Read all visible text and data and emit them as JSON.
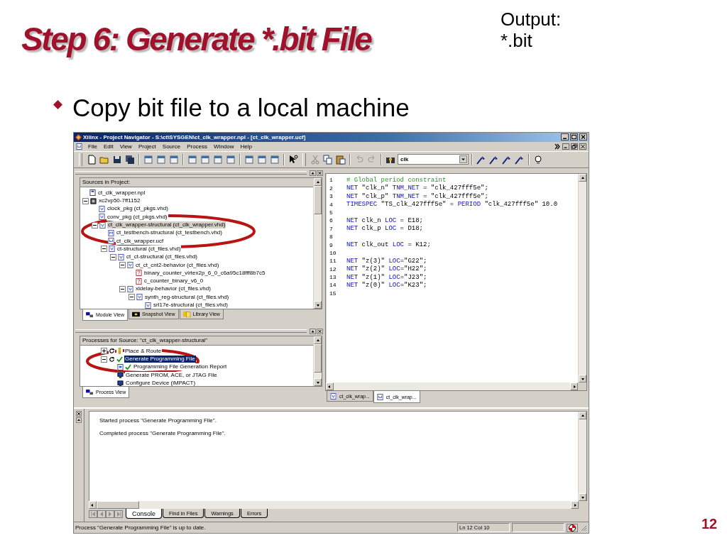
{
  "slide": {
    "title": "Step 6: Generate *.bit File",
    "note": [
      "Output:",
      "*.bit"
    ],
    "bullet": "Copy bit file to a local machine",
    "page_number": "12"
  },
  "window": {
    "title": "Xilinx - Project Navigator - S:\\ct\\SYSGEN\\ct_clk_wrapper.npl - [ct_clk_wrapper.ucf]",
    "menu": [
      "File",
      "Edit",
      "View",
      "Project",
      "Source",
      "Process",
      "Window",
      "Help"
    ],
    "toolbar": {
      "search_value": "clk"
    },
    "sources": {
      "header": "Sources in Project:",
      "tree": [
        {
          "label": "ct_clk_wrapper.npl",
          "kind": "project",
          "selected": false
        },
        {
          "label": "xc2vp50-7ff1152",
          "kind": "device",
          "expanded": true,
          "selected": false,
          "children": [
            {
              "label": "clock_pkg (ct_pkgs.vhd)",
              "kind": "vhdl",
              "selected": false
            },
            {
              "label": "conv_pkg (ct_pkgs.vhd)",
              "kind": "vhdl",
              "selected": false
            },
            {
              "label": "ct_clk_wrapper-structural (ct_clk_wrapper.vhd)",
              "kind": "vhdl",
              "expanded": true,
              "selected": true,
              "children": [
                {
                  "label": "ct_testbench-structural (ct_testbench.vhd)",
                  "kind": "testbench",
                  "selected": false
                },
                {
                  "label": "ct_clk_wrapper.ucf",
                  "kind": "ucf",
                  "selected": false
                },
                {
                  "label": "ct-structural (ct_files.vhd)",
                  "kind": "vhdl",
                  "expanded": true,
                  "selected": false,
                  "children": [
                    {
                      "label": "ct_ct-structural (ct_files.vhd)",
                      "kind": "vhdl",
                      "expanded": true,
                      "selected": false,
                      "children": [
                        {
                          "label": "ct_ct_cnt2-behavior (ct_files.vhd)",
                          "kind": "vhdl",
                          "expanded": true,
                          "selected": false,
                          "children": [
                            {
                              "label": "binary_counter_virtex2p_6_0_c6a95c18fff8b7c5",
                              "kind": "core",
                              "selected": false
                            },
                            {
                              "label": "c_counter_binary_v6_0",
                              "kind": "core",
                              "selected": false
                            }
                          ]
                        },
                        {
                          "label": "xldelay-behavior (ct_files.vhd)",
                          "kind": "vhdl",
                          "expanded": true,
                          "selected": false,
                          "children": [
                            {
                              "label": "synth_reg-structural (ct_files.vhd)",
                              "kind": "vhdl",
                              "expanded": true,
                              "selected": false,
                              "children": [
                                {
                                  "label": "srl17e-structural (ct_files.vhd)",
                                  "kind": "vhdl",
                                  "selected": false
                                }
                              ]
                            }
                          ]
                        }
                      ]
                    }
                  ]
                }
              ]
            }
          ]
        }
      ],
      "tabs": [
        {
          "label": "Module View",
          "selected": true
        },
        {
          "label": "Snapshot View",
          "selected": false
        },
        {
          "label": "Library View",
          "selected": false
        }
      ]
    },
    "processes": {
      "header": "Processes for Source: \"ct_clk_wrapper-structural\"",
      "tree": [
        {
          "label": "Place & Route",
          "kind": "process-warning",
          "expanded": false,
          "selected": false
        },
        {
          "label": "Generate Programming File",
          "kind": "process-ok",
          "expanded": true,
          "selected": true,
          "children": [
            {
              "label": "Programming File Generation Report",
              "kind": "report-ok",
              "selected": false
            },
            {
              "label": "Generate PROM, ACE, or JTAG File",
              "kind": "tool",
              "selected": false
            },
            {
              "label": "Configure Device (iMPACT)",
              "kind": "tool",
              "selected": false
            }
          ]
        }
      ],
      "tabs": [
        {
          "label": "Process View",
          "selected": true
        }
      ]
    },
    "editor": {
      "lines": [
        {
          "number": "1",
          "tokens": [
            {
              "kind": "comment",
              "text": "# Global period constraint"
            }
          ]
        },
        {
          "number": "2",
          "tokens": [
            {
              "kind": "keyword",
              "text": "NET"
            },
            {
              "kind": "text",
              "text": " \"clk_n\" "
            },
            {
              "kind": "keyword",
              "text": "TNM_NET"
            },
            {
              "kind": "text",
              "text": " = \"clk_427fff5e\";"
            }
          ]
        },
        {
          "number": "3",
          "tokens": [
            {
              "kind": "keyword",
              "text": "NET"
            },
            {
              "kind": "text",
              "text": " \"clk_p\" "
            },
            {
              "kind": "keyword",
              "text": "TNM_NET"
            },
            {
              "kind": "text",
              "text": " = \"clk_427fff5e\";"
            }
          ]
        },
        {
          "number": "4",
          "tokens": [
            {
              "kind": "keyword",
              "text": "TIMESPEC"
            },
            {
              "kind": "text",
              "text": " \"TS_clk_427fff5e\" = "
            },
            {
              "kind": "keyword",
              "text": "PERIOD"
            },
            {
              "kind": "text",
              "text": " \"clk_427fff5e\" 10.0"
            }
          ]
        },
        {
          "number": "5"
        },
        {
          "number": "6",
          "tokens": [
            {
              "kind": "keyword",
              "text": "NET"
            },
            {
              "kind": "text",
              "text": " clk_n "
            },
            {
              "kind": "keyword",
              "text": "LOC"
            },
            {
              "kind": "text",
              "text": " = E18;"
            }
          ]
        },
        {
          "number": "7",
          "tokens": [
            {
              "kind": "keyword",
              "text": "NET"
            },
            {
              "kind": "text",
              "text": " clk_p "
            },
            {
              "kind": "keyword",
              "text": "LOC"
            },
            {
              "kind": "text",
              "text": " = D18;"
            }
          ]
        },
        {
          "number": "8"
        },
        {
          "number": "9",
          "tokens": [
            {
              "kind": "keyword",
              "text": "NET"
            },
            {
              "kind": "text",
              "text": " clk_out "
            },
            {
              "kind": "keyword",
              "text": "LOC"
            },
            {
              "kind": "text",
              "text": " = K12;"
            }
          ]
        },
        {
          "number": "10"
        },
        {
          "number": "11",
          "tokens": [
            {
              "kind": "keyword",
              "text": "NET"
            },
            {
              "kind": "text",
              "text": " \"z(3)\" "
            },
            {
              "kind": "keyword",
              "text": "LOC"
            },
            {
              "kind": "text",
              "text": "=\"G22\";"
            }
          ]
        },
        {
          "number": "12",
          "tokens": [
            {
              "kind": "keyword",
              "text": "NET"
            },
            {
              "kind": "text",
              "text": " \"z(2)\" "
            },
            {
              "kind": "keyword",
              "text": "LOC"
            },
            {
              "kind": "text",
              "text": "=\"H22\";"
            }
          ]
        },
        {
          "number": "13",
          "tokens": [
            {
              "kind": "keyword",
              "text": "NET"
            },
            {
              "kind": "text",
              "text": " \"z(1)\" "
            },
            {
              "kind": "keyword",
              "text": "LOC"
            },
            {
              "kind": "text",
              "text": "=\"J23\";"
            }
          ]
        },
        {
          "number": "14",
          "tokens": [
            {
              "kind": "keyword",
              "text": "NET"
            },
            {
              "kind": "text",
              "text": " \"z(0)\" "
            },
            {
              "kind": "keyword",
              "text": "LOC"
            },
            {
              "kind": "text",
              "text": "=\"K23\";"
            }
          ]
        },
        {
          "number": "15"
        }
      ],
      "tabs": [
        {
          "label": "ct_clk_wrap...",
          "kind": "vhdl",
          "selected": false
        },
        {
          "label": "ct_clk_wrap...",
          "kind": "ucf",
          "selected": true
        }
      ]
    },
    "console": {
      "lines": [
        "Started process \"Generate Programming File\".",
        "Completed process \"Generate Programming File\"."
      ],
      "tabs": [
        {
          "label": "Console",
          "selected": true
        },
        {
          "label": "Find in Files",
          "selected": false
        },
        {
          "label": "Warnings",
          "selected": false
        },
        {
          "label": "Errors",
          "selected": false
        }
      ]
    },
    "status_bar": {
      "message": "Process \"Generate Programming File\" is up to date.",
      "position": "Ln 12 Col 10"
    }
  }
}
